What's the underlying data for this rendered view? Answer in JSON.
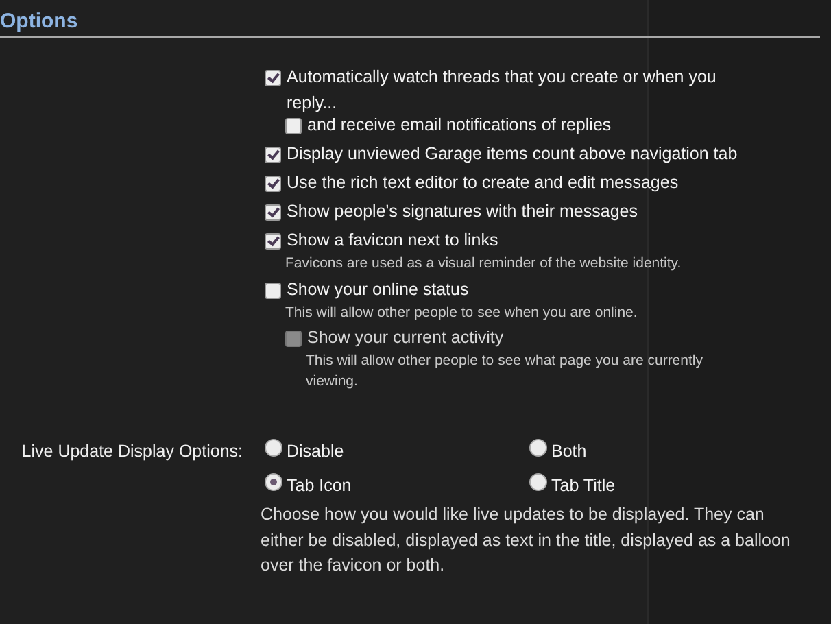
{
  "title": "Options",
  "options": [
    {
      "label": "Automatically watch threads that you create or when you reply...",
      "checked": true,
      "disabled": false,
      "children": [
        {
          "label": "and receive email notifications of replies",
          "checked": false,
          "disabled": false
        }
      ]
    },
    {
      "label": "Display unviewed Garage items count above navigation tab",
      "checked": true,
      "disabled": false
    },
    {
      "label": "Use the rich text editor to create and edit messages",
      "checked": true,
      "disabled": false
    },
    {
      "label": "Show people's signatures with their messages",
      "checked": true,
      "disabled": false
    },
    {
      "label": "Show a favicon next to links",
      "checked": true,
      "disabled": false,
      "hint": "Favicons are used as a visual reminder of the website identity."
    },
    {
      "label": "Show your online status",
      "checked": false,
      "disabled": false,
      "hint": "This will allow other people to see when you are online.",
      "children": [
        {
          "label": "Show your current activity",
          "checked": false,
          "disabled": true,
          "hint": "This will allow other people to see what page you are currently viewing."
        }
      ]
    }
  ],
  "live_update": {
    "label": "Live Update Display Options:",
    "choices": [
      {
        "label": "Disable",
        "selected": false
      },
      {
        "label": "Both",
        "selected": false
      },
      {
        "label": "Tab Icon",
        "selected": true
      },
      {
        "label": "Tab Title",
        "selected": false
      }
    ],
    "explanation": "Choose how you would like live updates to be displayed. They can either be disabled, displayed as text in the title, displayed as a balloon over the favicon or both."
  }
}
